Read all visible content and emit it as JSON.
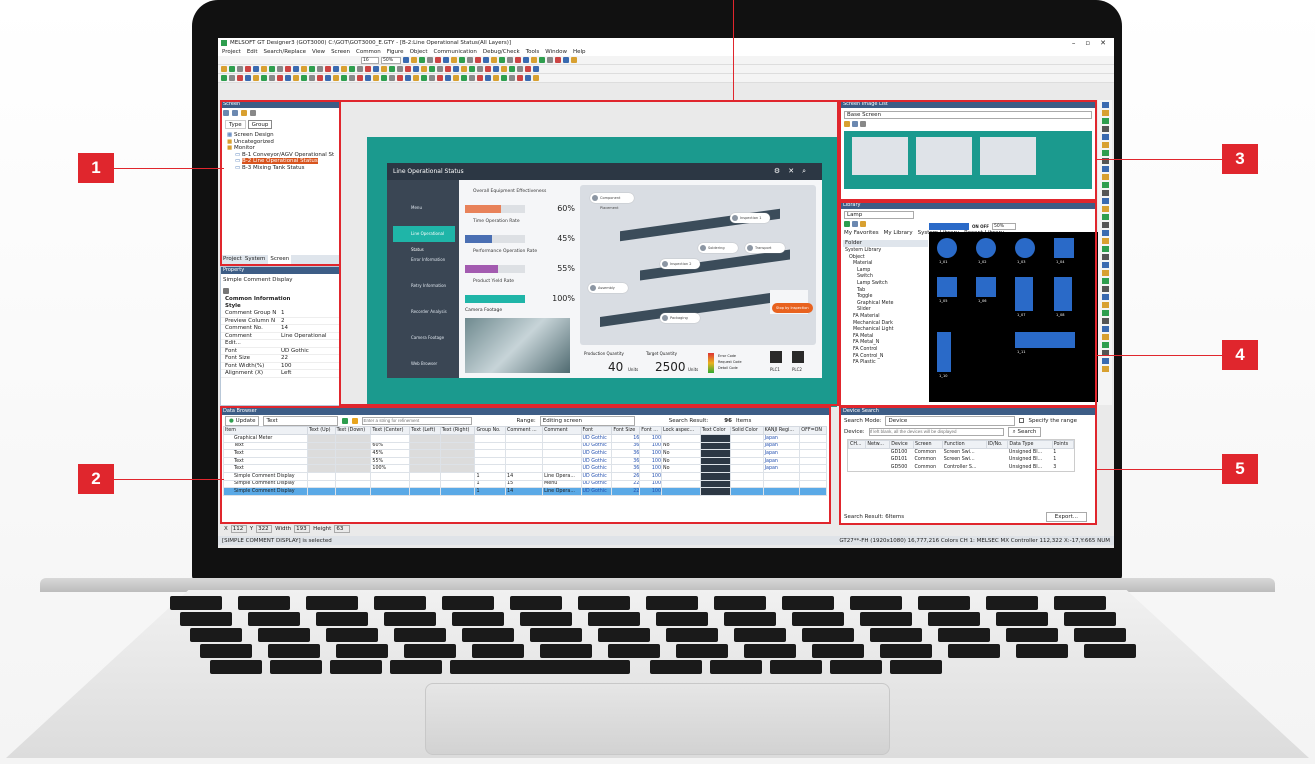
{
  "window": {
    "title": "MELSOFT GT Designer3 (GOT3000) C:\\GOT\\GOT3000_E.GTY - [B-2:Line Operational Status(All Layers)]",
    "controls": [
      "–",
      "▫",
      "✕"
    ]
  },
  "menu": [
    "Project",
    "Edit",
    "Search/Replace",
    "View",
    "Screen",
    "Common",
    "Figure",
    "Object",
    "Communication",
    "Debug/Check",
    "Tools",
    "Window",
    "Help"
  ],
  "toolbar": {
    "zoom": "50%",
    "size": "16"
  },
  "callouts": [
    "1",
    "2",
    "3",
    "4",
    "5"
  ],
  "screen_panel": {
    "title": "Screen",
    "tabs": [
      "Type",
      "Group"
    ],
    "tree": [
      "Screen Design",
      "Uncategorized",
      "Monitor",
      "B-1 Conveyor/AGV Operational St",
      "B-2 Line Operational Status",
      "B-3 Mixing Tank Status"
    ],
    "bottom_tabs": [
      "Project",
      "System",
      "Screen"
    ]
  },
  "property_panel": {
    "title": "Property",
    "object": "Simple Comment Display",
    "section1": "Common Information",
    "section2": "Style",
    "rows": [
      {
        "k": "Comment Group N",
        "v": "1"
      },
      {
        "k": "Preview Column N",
        "v": "2"
      },
      {
        "k": "Comment No.",
        "v": "14"
      },
      {
        "k": "Comment",
        "v": "Line Operational"
      },
      {
        "k": "Edit...",
        "v": ""
      },
      {
        "k": "Font",
        "v": "UD Gothic"
      },
      {
        "k": "Font Size",
        "v": "22"
      },
      {
        "k": "Font Width(%)",
        "v": "100"
      },
      {
        "k": "Alignment (X)",
        "v": "Left"
      }
    ]
  },
  "hmi": {
    "title": "Line Operational Status",
    "nav": [
      "Menu",
      "Line Operational Status",
      "Error Information",
      "Retry Information",
      "Recorder Analysis",
      "Camera Footage",
      "Web Browser"
    ],
    "kpis": [
      {
        "label": "Overall Equipment Effectiveness",
        "value": "60%",
        "pct": 0.6,
        "color": "#e8825a"
      },
      {
        "label": "Time Operation Rate",
        "value": "45%",
        "pct": 0.45,
        "color": "#4a6fb3"
      },
      {
        "label": "Performance Operation Rate",
        "value": "55%",
        "pct": 0.55,
        "color": "#a35bb0"
      },
      {
        "label": "Product Yield Rate",
        "value": "100%",
        "pct": 1.0,
        "color": "#1fb5a8"
      }
    ],
    "camera": "Camera Footage",
    "stations": [
      "Component Placement",
      "Inspection 1",
      "Soldering",
      "Transport",
      "Inspection 2",
      "Assembly",
      "Packaging",
      "Stop by Inspection"
    ],
    "production_label": "Production Quantity",
    "production_value": "40",
    "production_unit": "Units",
    "target_label": "Target Quantity",
    "target_value": "2500",
    "target_unit": "Units",
    "codes": [
      "Error Code",
      "Request Code",
      "Detail Code"
    ],
    "plcs": [
      "PLC1",
      "PLC2"
    ]
  },
  "screen_image_list": {
    "title": "Screen Image List",
    "select": "Base Screen"
  },
  "library": {
    "title": "Library",
    "select": "Lamp",
    "tabs": [
      "My Favorites",
      "My Library",
      "System Library",
      "Recent Library"
    ],
    "folder": "Folder",
    "tree": [
      "System Library",
      "Object",
      "Material",
      "Lamp",
      "Switch",
      "Lamp Switch",
      "Tab",
      "Toggle",
      "Graphical Mete",
      "Slider",
      "FA Material",
      "Mechanical Dark",
      "Mechanical Light",
      "FA Metal",
      "FA Metal_N",
      "FA Control",
      "FA Control_N",
      "FA Plastic"
    ],
    "zoom": "50%",
    "items": [
      "1_01",
      "1_02",
      "1_03",
      "1_04",
      "1_05",
      "1_06",
      "1_07",
      "1_08",
      "1_10",
      "1_11"
    ]
  },
  "data_browser": {
    "title": "Data Browser",
    "update": "Update",
    "filter": "Text",
    "search_placeholder": "Enter a string for refinement",
    "range_label": "Range:",
    "range_value": "Editing screen",
    "result_label": "Search Result:",
    "result_value": "96",
    "result_unit": "Items",
    "columns": [
      "Item",
      "Text (Up)",
      "Text (Down)",
      "Text (Center)",
      "Text (Left)",
      "Text (Right)",
      "Group No.",
      "Comment ...",
      "Comment",
      "Font",
      "Font Size",
      "Font ...",
      "Lock aspec...",
      "Text Color",
      "Solid Color",
      "KANJI Regi...",
      "OFF=ON"
    ],
    "rows": [
      [
        "Graphical Meter",
        "",
        "",
        "",
        "",
        "",
        "",
        "",
        "",
        "UD Gothic",
        "16",
        "100",
        "",
        "",
        "",
        "Japan",
        ""
      ],
      [
        "Text",
        "",
        "",
        "60%",
        "",
        "",
        "",
        "",
        "",
        "UD Gothic",
        "36",
        "100",
        "No",
        "",
        "",
        "Japan",
        ""
      ],
      [
        "Text",
        "",
        "",
        "45%",
        "",
        "",
        "",
        "",
        "",
        "UD Gothic",
        "36",
        "100",
        "No",
        "",
        "",
        "Japan",
        ""
      ],
      [
        "Text",
        "",
        "",
        "55%",
        "",
        "",
        "",
        "",
        "",
        "UD Gothic",
        "36",
        "100",
        "No",
        "",
        "",
        "Japan",
        ""
      ],
      [
        "Text",
        "",
        "",
        "100%",
        "",
        "",
        "",
        "",
        "",
        "UD Gothic",
        "36",
        "100",
        "No",
        "",
        "",
        "Japan",
        ""
      ],
      [
        "Simple Comment Display",
        "",
        "",
        "",
        "",
        "",
        "1",
        "14",
        "Line Opera...",
        "UD Gothic",
        "26",
        "100",
        "",
        "",
        "",
        "",
        ""
      ],
      [
        "Simple Comment Display",
        "",
        "",
        "",
        "",
        "",
        "1",
        "15",
        "Menu",
        "UD Gothic",
        "22",
        "100",
        "",
        "",
        "",
        "",
        ""
      ],
      [
        "Simple Comment Display",
        "",
        "",
        "",
        "",
        "",
        "1",
        "14",
        "Line Opera...",
        "UD Gothic",
        "22",
        "100",
        "",
        "",
        "",
        "",
        ""
      ]
    ]
  },
  "coords": {
    "x_label": "X",
    "x": "112",
    "y_label": "Y",
    "y": "322",
    "w_label": "Width",
    "w": "193",
    "h_label": "Height",
    "h": "63"
  },
  "status": {
    "left": "[SIMPLE COMMENT DISPLAY] is selected",
    "right": "GT27**-FH (1920x1080)  16,777,216 Colors  CH 1: MELSEC MX Controller  112,322  X:-17,Y:665  NUM"
  },
  "device_search": {
    "title": "Device Search",
    "mode_label": "Search Mode:",
    "mode_value": "Device",
    "range_check": "Specify the range",
    "device_label": "Device:",
    "device_placeholder": "If left blank, all the devices will be displayed",
    "search_button": "Search",
    "columns": [
      "CH...",
      "Netw...",
      "Device",
      "Screen",
      "Function",
      "ID/No.",
      "Data Type",
      "Points"
    ],
    "rows": [
      [
        "",
        "",
        "GD100",
        "Common",
        "Screen Swi...",
        "",
        "Unsigned BI...",
        "1"
      ],
      [
        "",
        "",
        "GD101",
        "Common",
        "Screen Swi...",
        "",
        "Unsigned BI...",
        "1"
      ],
      [
        "",
        "",
        "GD500",
        "Common",
        "Controller S...",
        "",
        "Unsigned BI...",
        "3"
      ]
    ],
    "result": "Search Result: 6Items",
    "export": "Export..."
  },
  "colors": {
    "accent": "#e0262d",
    "teal": "#1b9a8e",
    "panel_head": "#3d5d86"
  }
}
